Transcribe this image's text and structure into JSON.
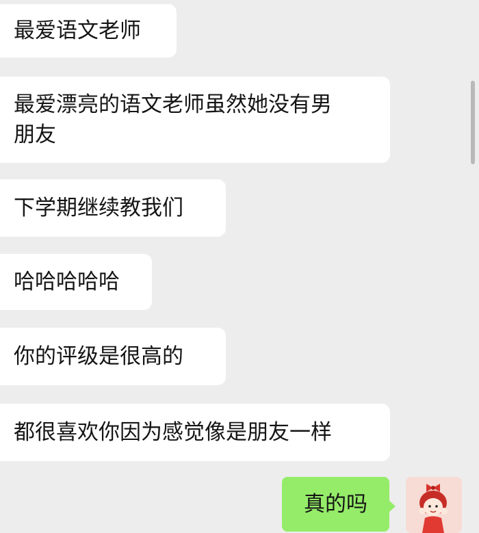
{
  "messages": [
    {
      "sender": "other",
      "text": "最爱语文老师"
    },
    {
      "sender": "other",
      "text": "最爱漂亮的语文老师虽然她没有男\n朋友"
    },
    {
      "sender": "other",
      "text": "下学期继续教我们"
    },
    {
      "sender": "other",
      "text": "哈哈哈哈哈"
    },
    {
      "sender": "other",
      "text": "你的评级是很高的"
    },
    {
      "sender": "other",
      "text": "都很喜欢你因为感觉像是朋友一样"
    },
    {
      "sender": "self",
      "text": "真的吗"
    }
  ],
  "colors": {
    "background": "#ededed",
    "incoming_bubble": "#ffffff",
    "outgoing_bubble": "#95ec69"
  },
  "icons": {
    "self_avatar": "cartoon-girl-avatar-icon"
  }
}
